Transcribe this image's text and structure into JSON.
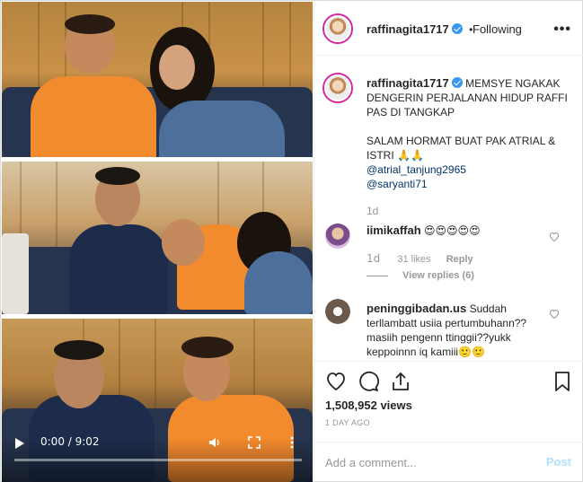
{
  "media": {
    "time_display": "0:00 / 9:02",
    "progress": 0.0
  },
  "header": {
    "username": "raffinagita1717",
    "separator": "•",
    "follow_status": "Following",
    "more_icon": "more-horizontal-icon"
  },
  "caption": {
    "username": "raffinagita1717",
    "text": "MEMSYE NGAKAK DENGERIN PERJALANAN HIDUP RAFFI PAS DI TANGKAP\n\nSALAM HORMAT BUAT PAK ATRIAL & ISTRI 🙏🙏",
    "mentions": [
      "@atrial_tanjung2965",
      "@saryanti71"
    ],
    "time": "1d"
  },
  "comments": [
    {
      "username": "iimikaffah",
      "text": "😍😍😍😍😍",
      "time": "1d",
      "likes": "31 likes",
      "reply_label": "Reply",
      "view_replies": "View replies (6)"
    },
    {
      "username": "peninggibadan.us",
      "text": "Suddah terllambatt usiia pertumbuhann?? masiih pengenn ttinggii??yukk keppoinnn iq kamiii🙂🙂"
    }
  ],
  "actions": {
    "likes_label": "1,508,952 views",
    "post_time": "1 DAY AGO"
  },
  "comment_box": {
    "placeholder": "Add a comment...",
    "post_label": "Post"
  },
  "colors": {
    "verified": "#3897f0",
    "mention": "#003569",
    "post_disabled": "#b2dffc"
  }
}
